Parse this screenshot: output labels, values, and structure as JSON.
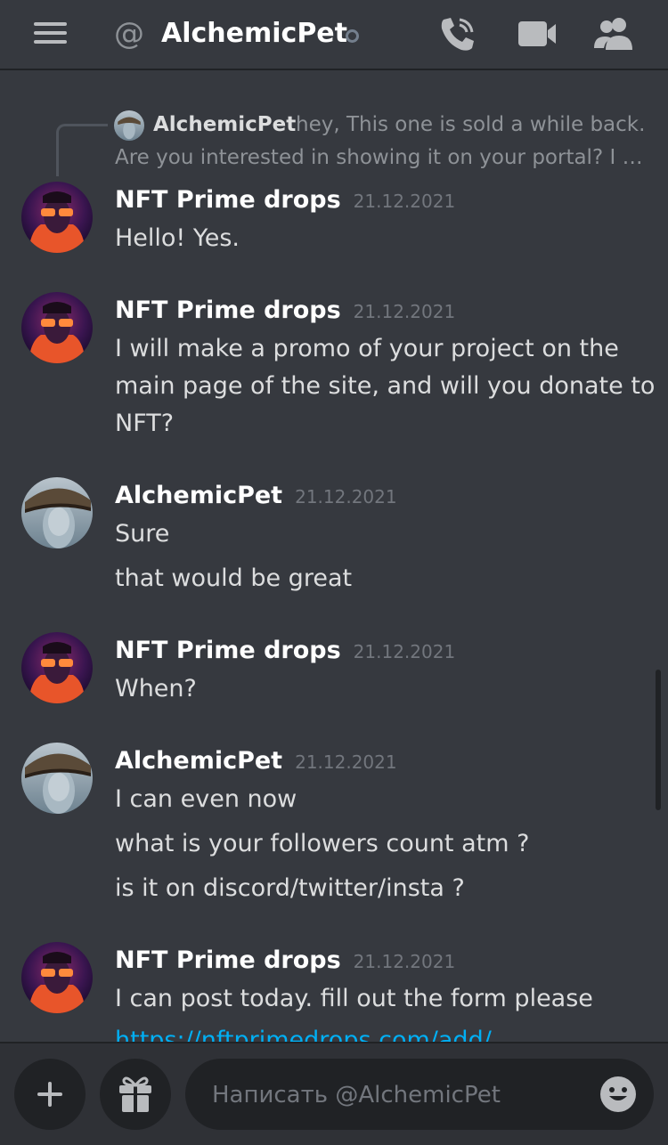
{
  "header": {
    "at_symbol": "@",
    "title": "AlchemicPet",
    "icons": [
      "hamburger-menu-icon",
      "phone-call-icon",
      "video-camera-icon",
      "members-icon"
    ]
  },
  "reply": {
    "author": "AlchemicPet",
    "text_line1": "hey, This one is sold a while back.",
    "text_line2": "Are you interested in showing it on your portal? I will make a promo of your project on the main page"
  },
  "messages": [
    {
      "author": "NFT Prime drops",
      "time": "21.12.2021",
      "lines": [
        "Hello! Yes."
      ]
    },
    {
      "author": "NFT Prime drops",
      "time": "21.12.2021",
      "lines": [
        "I will make a promo of your project on the",
        "main page of the site, and will you donate to",
        "NFT?"
      ]
    },
    {
      "author": "AlchemicPet",
      "time": "21.12.2021",
      "lines": [
        "Sure",
        "that would be great"
      ]
    },
    {
      "author": "NFT Prime drops",
      "time": "21.12.2021",
      "lines": [
        "When?"
      ]
    },
    {
      "author": "AlchemicPet",
      "time": "21.12.2021",
      "lines": [
        "I can even now",
        "what is your followers count atm ?",
        "is it on discord/twitter/insta ?"
      ]
    },
    {
      "author": "NFT Prime drops",
      "time": "21.12.2021",
      "lines": [
        "I can post today.  fill out the form please",
        "https://nftprimedrops.com/add/"
      ]
    }
  ],
  "composer": {
    "placeholder": "Написать @AlchemicPet",
    "icons": [
      "plus-icon",
      "gift-icon",
      "emoji-icon"
    ]
  },
  "colors": {
    "background": "#36393f",
    "input_bar": "#2f3136",
    "link": "#00aff4",
    "timestamp": "#72767d"
  }
}
